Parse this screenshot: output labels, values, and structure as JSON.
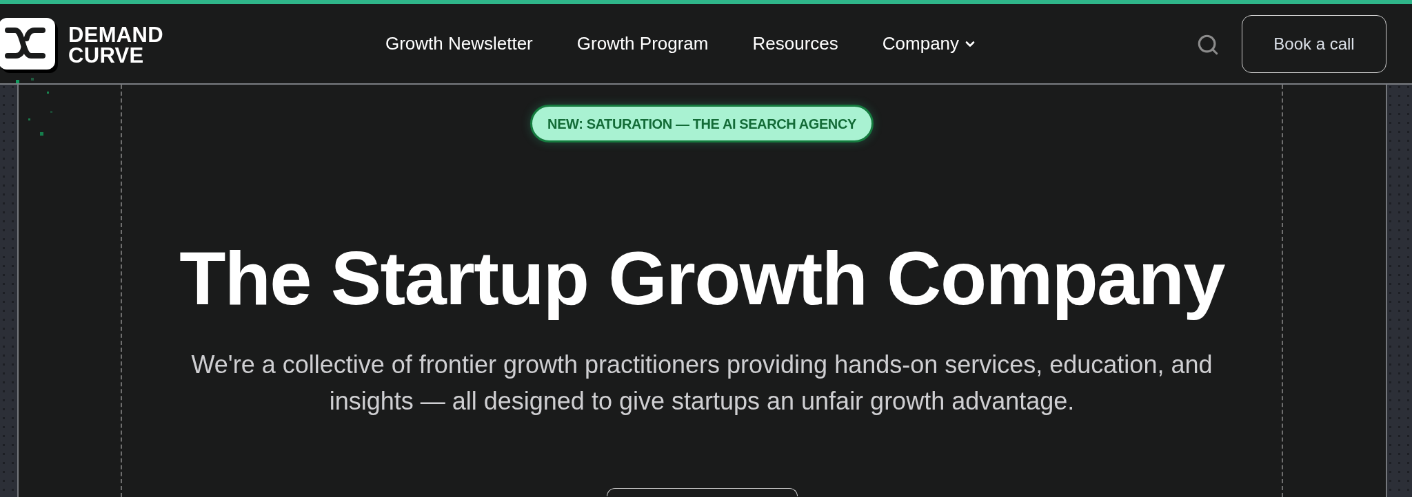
{
  "logo": {
    "line_1": "DEMAND",
    "line_2": "CURVE"
  },
  "nav": {
    "items": [
      {
        "label": "Growth Newsletter",
        "kind": "link"
      },
      {
        "label": "Growth Program",
        "kind": "link"
      },
      {
        "label": "Resources",
        "kind": "link"
      },
      {
        "label": "Company",
        "kind": "dropdown"
      }
    ]
  },
  "header_actions": {
    "cta": "Book a call"
  },
  "hero": {
    "badge": "NEW: SATURATION — THE AI SEARCH AGENCY",
    "title": "The Startup Growth Company",
    "subtitle": "We're a collective of frontier growth practitioners providing hands-on services, education, and insights — all designed to give startups an unfair growth advantage."
  }
}
